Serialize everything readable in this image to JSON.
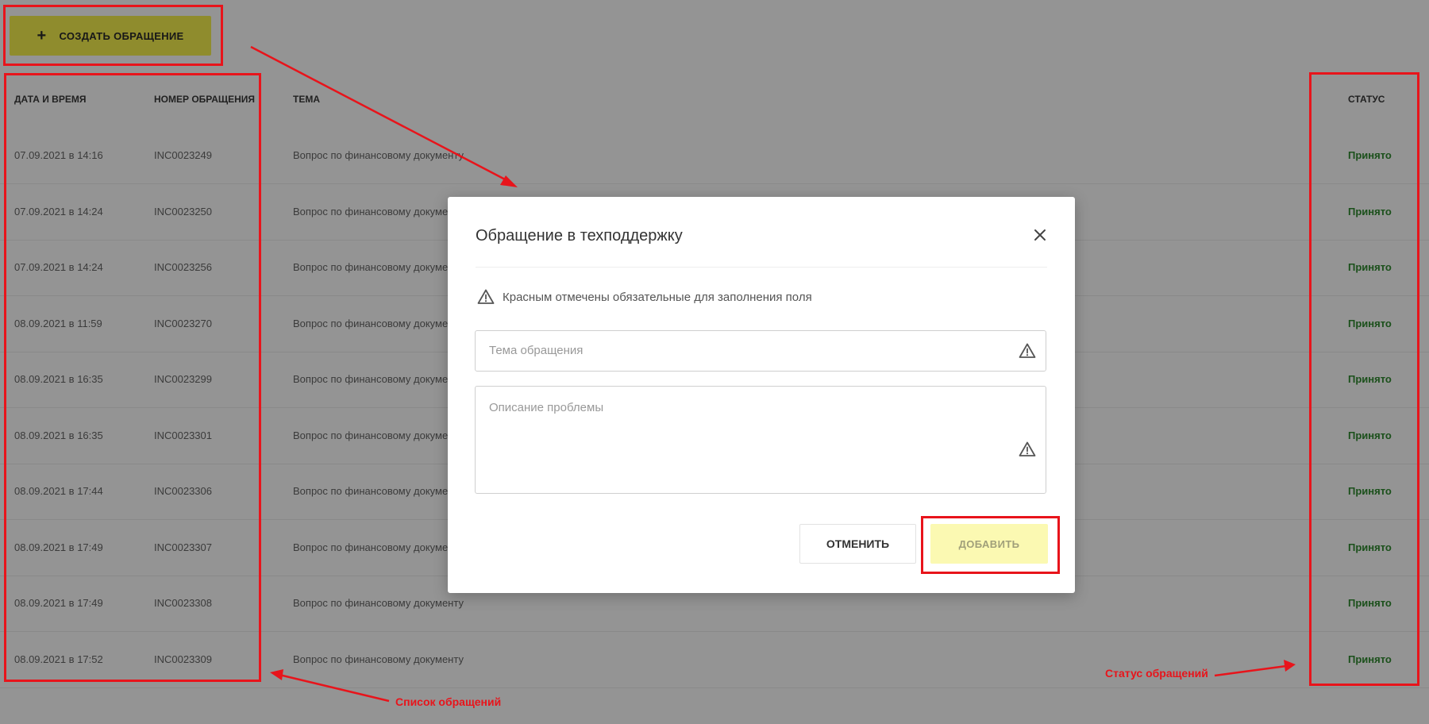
{
  "toolbar": {
    "plus_icon": "+",
    "create_label": "СОЗДАТЬ ОБРАЩЕНИЕ",
    "accent_color": "#f6f24f"
  },
  "table": {
    "columns": {
      "datetime": "ДАТА И ВРЕМЯ",
      "number": "НОМЕР ОБРАЩЕНИЯ",
      "topic": "ТЕМА",
      "status": "СТАТУС"
    },
    "rows": [
      {
        "datetime": "07.09.2021 в 14:16",
        "number": "INC0023249",
        "topic": "Вопрос по финансовому документу",
        "status": "Принято"
      },
      {
        "datetime": "07.09.2021 в 14:24",
        "number": "INC0023250",
        "topic": "Вопрос по финансовому документу",
        "status": "Принято"
      },
      {
        "datetime": "07.09.2021 в 14:24",
        "number": "INC0023256",
        "topic": "Вопрос по финансовому документу",
        "status": "Принято"
      },
      {
        "datetime": "08.09.2021 в 11:59",
        "number": "INC0023270",
        "topic": "Вопрос по финансовому документу",
        "status": "Принято"
      },
      {
        "datetime": "08.09.2021 в 16:35",
        "number": "INC0023299",
        "topic": "Вопрос по финансовому документу",
        "status": "Принято"
      },
      {
        "datetime": "08.09.2021 в 16:35",
        "number": "INC0023301",
        "topic": "Вопрос по финансовому документу",
        "status": "Принято"
      },
      {
        "datetime": "08.09.2021 в 17:44",
        "number": "INC0023306",
        "topic": "Вопрос по финансовому документу",
        "status": "Принято"
      },
      {
        "datetime": "08.09.2021 в 17:49",
        "number": "INC0023307",
        "topic": "Вопрос по финансовому документу",
        "status": "Принято"
      },
      {
        "datetime": "08.09.2021 в 17:49",
        "number": "INC0023308",
        "topic": "Вопрос по финансовому документу",
        "status": "Принято"
      },
      {
        "datetime": "08.09.2021 в 17:52",
        "number": "INC0023309",
        "topic": "Вопрос по финансовому документу",
        "status": "Принято"
      }
    ],
    "status_color": "#2f8a2f"
  },
  "modal": {
    "title": "Обращение в техподдержку",
    "close_icon": "close-icon",
    "notice": "Красным отмечены обязательные для заполнения поля",
    "subject_placeholder": "Тема обращения",
    "description_placeholder": "Описание проблемы",
    "cancel_label": "ОТМЕНИТЬ",
    "add_label": "ДОБАВИТЬ",
    "warning_icon": "warning-icon"
  },
  "annotations": {
    "list_label": "Список обращений",
    "status_label": "Статус обращений",
    "color": "#e8141b"
  }
}
